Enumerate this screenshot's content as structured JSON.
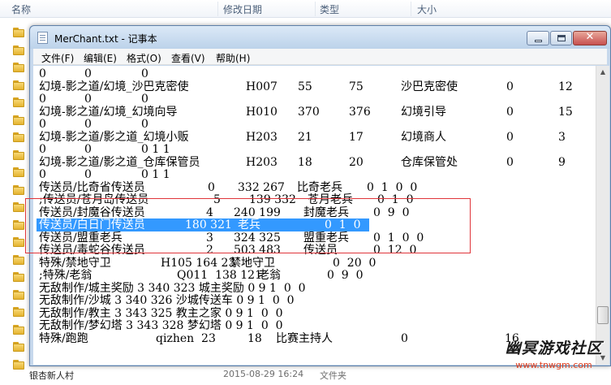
{
  "explorer": {
    "columns": [
      "名称",
      "修改日期",
      "类型",
      "大小"
    ],
    "footer_row": {
      "name": "银杏新人村",
      "date": "2015-08-29 16:24",
      "type": "文件夹"
    }
  },
  "window": {
    "title": "MerChant.txt - 记事本",
    "close_glyph": "✕"
  },
  "menu": [
    "文件(F)",
    "编辑(E)",
    "格式(O)",
    "查看(V)",
    "帮助(H)"
  ],
  "lines": [
    [
      "0",
      "0",
      "0"
    ],
    [
      "幻境-影之道/幻境_沙巴克密使",
      "H007",
      "55",
      "75",
      "沙巴克密使",
      "0",
      "12"
    ],
    [
      "0",
      "0",
      "0"
    ],
    [
      "幻境-影之道/幻境_幻境向导",
      "H010",
      "370",
      "376",
      "幻境引导",
      "0",
      "15"
    ],
    [
      "0",
      "0",
      "0"
    ],
    [
      "幻境-影之道/影之道_幻境小贩",
      "H203",
      "21",
      "17",
      "幻境商人",
      "0",
      "3"
    ],
    [
      "0",
      "0",
      "0 1 1"
    ],
    [
      "幻境-影之道/影之道_仓库保管员",
      "H203",
      "18",
      "20",
      "仓库保管处",
      "0",
      "9"
    ],
    [
      "0",
      "0",
      "0 1 1"
    ],
    [
      "传送员/比奇省传送员",
      "0",
      "332 267",
      "比奇老兵",
      "0  1  0  0"
    ],
    [
      ";传送员/苍月岛传送员",
      "5",
      "139 332",
      "苍月老兵",
      "0  1  0"
    ],
    [
      "传送员/封魔谷传送员",
      "4",
      "240 199",
      "封魔老兵",
      "0  9  0"
    ],
    [
      "传送员/白日门传送员",
      "180 321",
      "老兵",
      "0  1  0"
    ],
    [
      "传送员/盟重老兵",
      "3",
      "324 325",
      "盟重老兵",
      "0  1  0  0"
    ],
    [
      "传送员/毒蛇谷传送员",
      "2",
      "503 483",
      "传送员",
      "0  12  0"
    ],
    [
      "特殊/禁地守卫",
      "H105 164 23",
      "禁地守卫",
      "0  20  0"
    ],
    [
      ";特殊/老翁",
      "Q011  138 121",
      "老翁",
      "0  9  0"
    ],
    [
      "无敌制作/城主奖励 3 340 323 城主奖励 0 9 1  0  0"
    ],
    [
      "无敌制作/沙城 3 340 326 沙城传送车 0 9 1  0  0"
    ],
    [
      "无敌制作/教主 3 343 325 教主之家 0 9 1  0  0"
    ],
    [
      "无敌制作/梦幻塔 3 343 328 梦幻塔 0 9 1  0  0"
    ],
    [
      "特殊/跑跑",
      "qizhen  23",
      "18",
      "比赛主持人",
      "0",
      "16"
    ]
  ],
  "watermark": {
    "main": "幽冥游戏社区",
    "sub": "www.tnwgm.com"
  }
}
